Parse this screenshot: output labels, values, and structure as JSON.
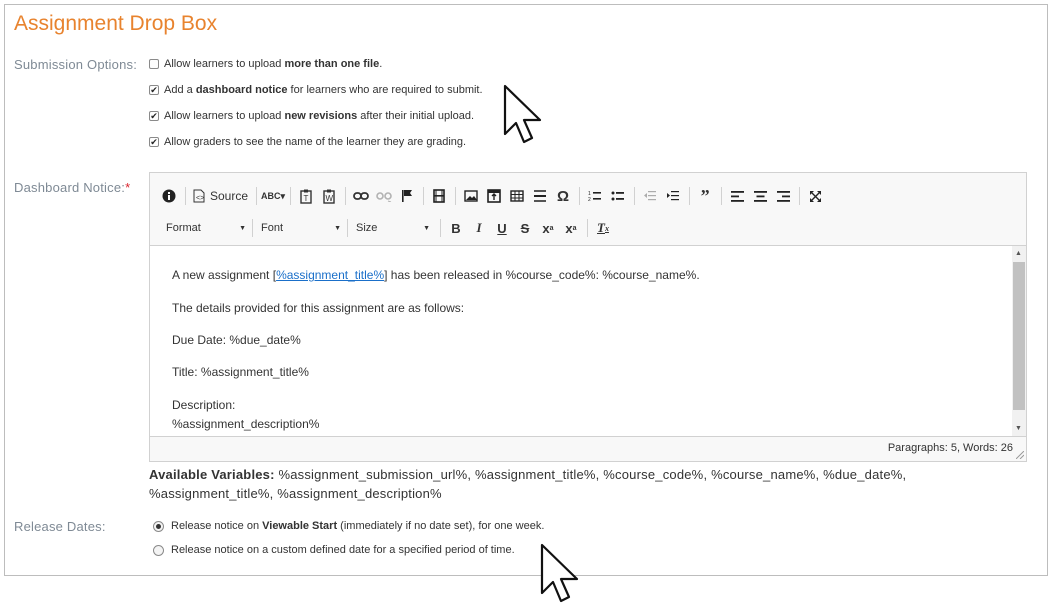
{
  "page_title": "Assignment Drop Box",
  "submission": {
    "label": "Submission Options:",
    "options": [
      {
        "checked": false,
        "pre": "Allow learners to upload ",
        "bold": "more than one file",
        "post": "."
      },
      {
        "checked": true,
        "pre": "Add a ",
        "bold": "dashboard notice",
        "post": " for learners who are required to submit."
      },
      {
        "checked": true,
        "pre": "Allow learners to upload ",
        "bold": "new revisions",
        "post": " after their initial upload."
      },
      {
        "checked": true,
        "pre": "Allow graders to see the name of the learner they are grading.",
        "bold": "",
        "post": ""
      }
    ]
  },
  "dashboard": {
    "label": "Dashboard Notice:",
    "required_mark": "*",
    "toolbar": {
      "source_label": "Source",
      "format_label": "Format",
      "font_label": "Font",
      "size_label": "Size"
    },
    "content": {
      "line1_pre": "A new assignment [",
      "line1_link": "%assignment_title%",
      "line1_post": "] has been released in %course_code%: %course_name%.",
      "line2": "The details provided for this assignment are as follows:",
      "line3": "Due Date: %due_date%",
      "line4": "Title: %assignment_title%",
      "line5a": "Description:",
      "line5b": "%assignment_description%"
    },
    "status": "Paragraphs: 5, Words: 26"
  },
  "variables": {
    "label": "Available Variables:",
    "text": " %assignment_submission_url%, %assignment_title%, %course_code%, %course_name%, %due_date%, %assignment_title%, %assignment_description%"
  },
  "release": {
    "label": "Release Dates:",
    "options": [
      {
        "selected": true,
        "pre": "Release notice on ",
        "bold": "Viewable Start",
        "post": " (immediately if no date set), for one week."
      },
      {
        "selected": false,
        "pre": "Release notice on a custom defined date for a specified period of time.",
        "bold": "",
        "post": ""
      }
    ]
  },
  "colors": {
    "accent": "#e8832e",
    "label": "#7f8a95",
    "link": "#1a6fc9",
    "required": "#d9232d"
  }
}
